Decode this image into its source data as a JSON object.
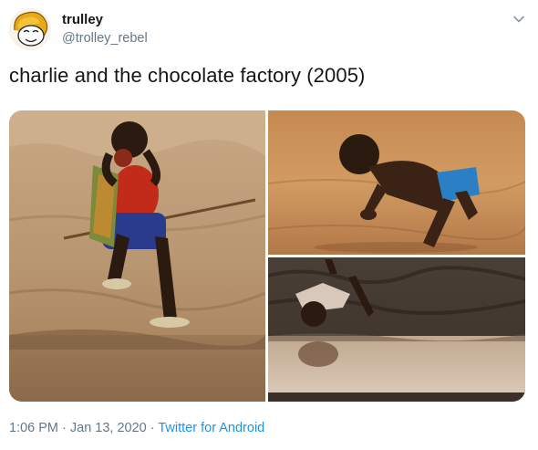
{
  "user": {
    "name": "trulley",
    "handle": "@trolley_rebel",
    "avatar_icon": "cartoon-face-avatar"
  },
  "menu": {
    "icon": "chevron-down-icon"
  },
  "tweet": {
    "text": "charlie and the chocolate factory (2005)"
  },
  "media": {
    "photos": [
      {
        "subject": "child-drinking-from-cup-by-muddy-water"
      },
      {
        "subject": "child-drinking-from-muddy-river"
      },
      {
        "subject": "child-lying-on-mud-drinking-from-puddle"
      }
    ]
  },
  "meta": {
    "time": "1:06 PM",
    "sep1": " · ",
    "date": "Jan 13, 2020",
    "sep2": " · ",
    "source": "Twitter for Android"
  },
  "colors": {
    "primary_text": "#14171a",
    "secondary_text": "#657786",
    "link": "#1b95e0"
  }
}
